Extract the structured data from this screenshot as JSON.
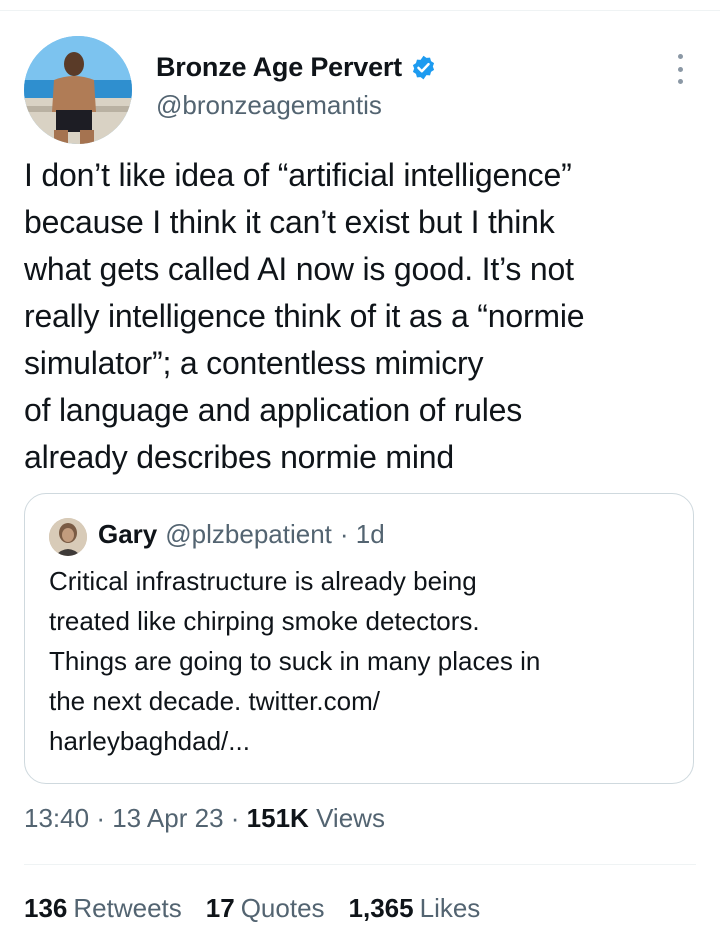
{
  "author": {
    "display_name": "Bronze Age Pervert",
    "handle": "@bronzeagemantis",
    "verified": true
  },
  "tweet": {
    "text": "I don’t like idea of “artificial intelligence”\nbecause I think it can’t exist but I think\nwhat gets called AI now is good. It’s not\nreally intelligence think of it as a “normie\nsimulator”; a contentless mimicry\nof language and application of rules\nalready describes normie mind"
  },
  "quote": {
    "name": "Gary",
    "handle": "@plzbepatient",
    "age": "· 1d",
    "text": "Critical infrastructure is already being\ntreated like chirping smoke detectors.\nThings are going to suck in many places in\nthe next decade. twitter.com/\nharleybaghdad/..."
  },
  "meta": {
    "time": "13:40",
    "sep1": "·",
    "date": "13 Apr 23",
    "sep2": "·",
    "views_count": "151K",
    "views_label": "Views"
  },
  "stats": {
    "retweets_count": "136",
    "retweets_label": "Retweets",
    "quotes_count": "17",
    "quotes_label": "Quotes",
    "likes_count": "1,365",
    "likes_label": "Likes"
  },
  "colors": {
    "verified": "#1d9bf0",
    "secondary_text": "#536471",
    "border": "#cfd9de"
  },
  "icons": {
    "more": "more-vertical-icon",
    "verified": "verified-badge-icon"
  }
}
